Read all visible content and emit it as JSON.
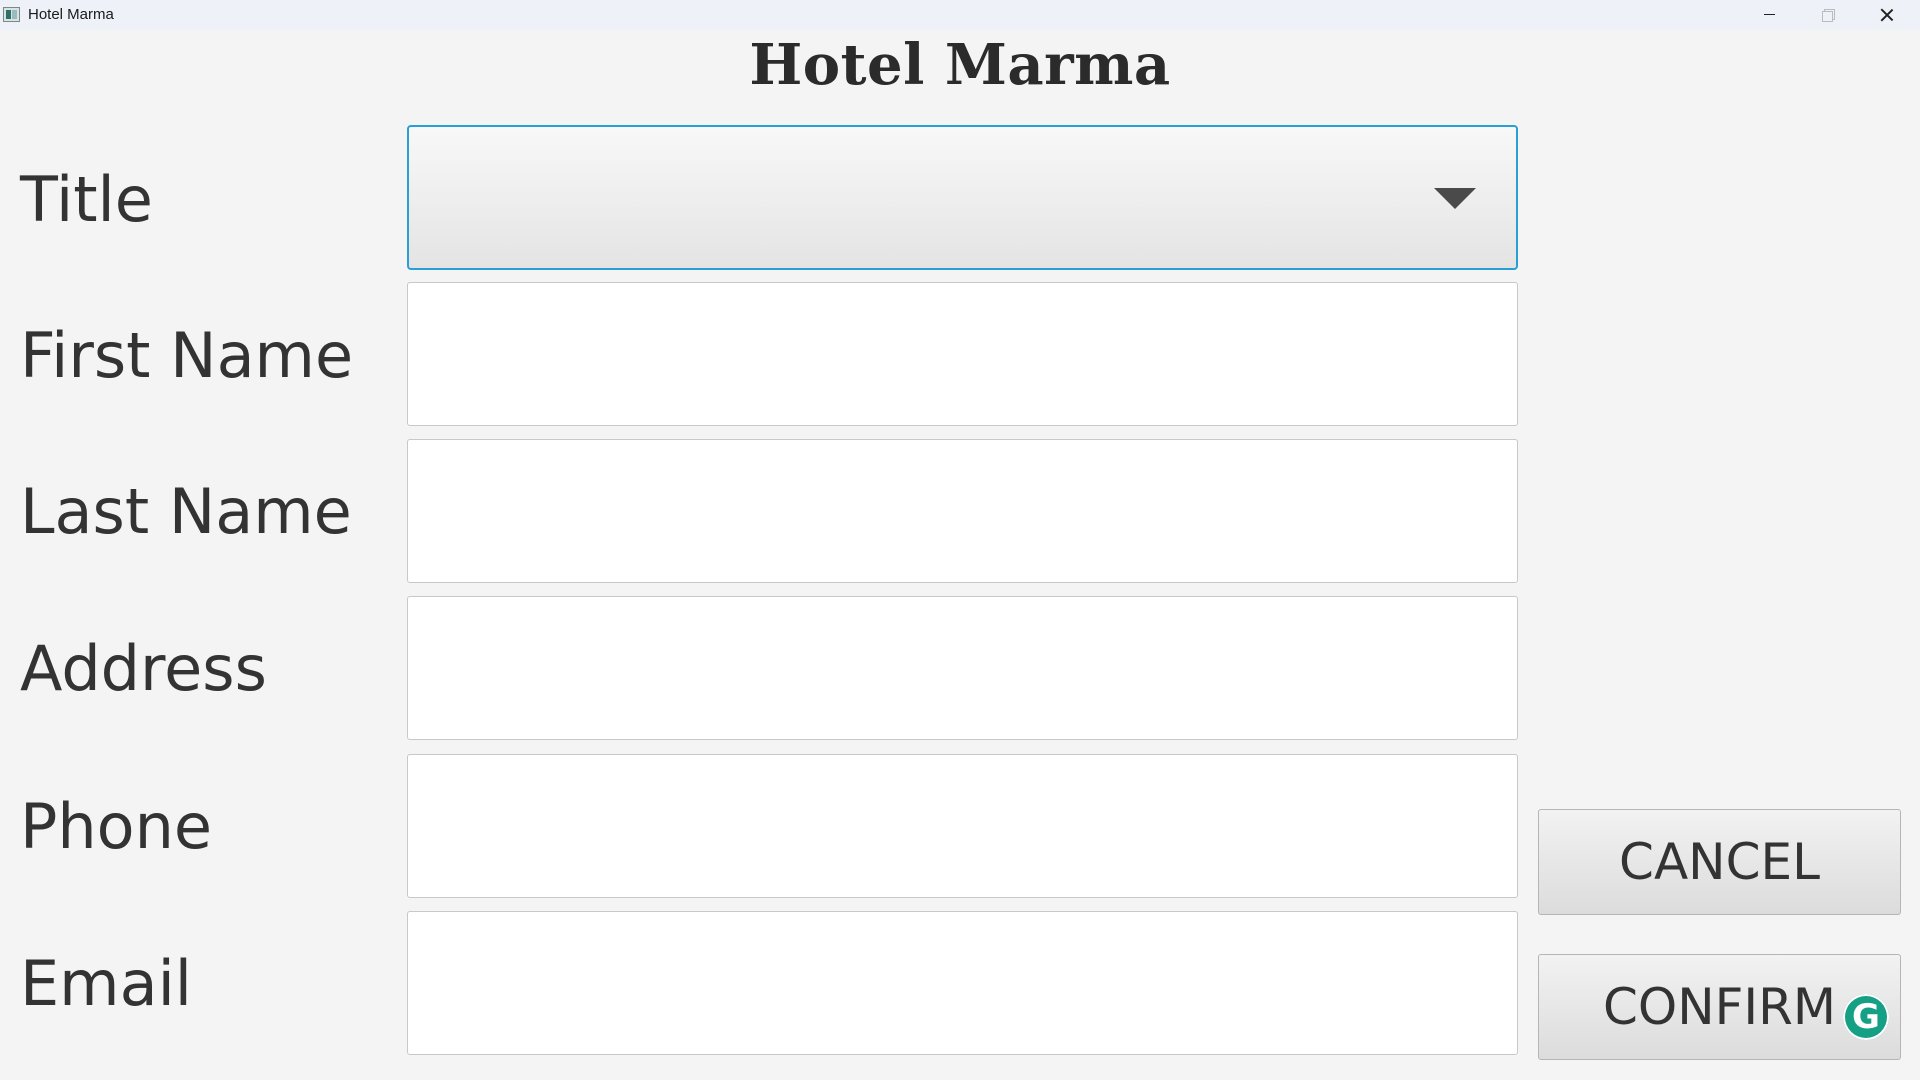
{
  "window": {
    "title": "Hotel Marma"
  },
  "header": {
    "title": "Hotel Marma"
  },
  "form": {
    "title": {
      "label": "Title",
      "value": ""
    },
    "first_name": {
      "label": "First Name",
      "value": ""
    },
    "last_name": {
      "label": "Last Name",
      "value": ""
    },
    "address": {
      "label": "Address",
      "value": ""
    },
    "phone": {
      "label": "Phone",
      "value": ""
    },
    "email": {
      "label": "Email",
      "value": ""
    }
  },
  "buttons": {
    "cancel": "CANCEL",
    "confirm": "CONFIRM"
  },
  "icons": {
    "app": "app-window-icon",
    "dropdown": "chevron-down-icon",
    "grammarly": "grammarly-icon"
  },
  "colors": {
    "focus_border": "#2a9fd6",
    "grammarly": "#15a085"
  },
  "grammarly_glyph": "G"
}
